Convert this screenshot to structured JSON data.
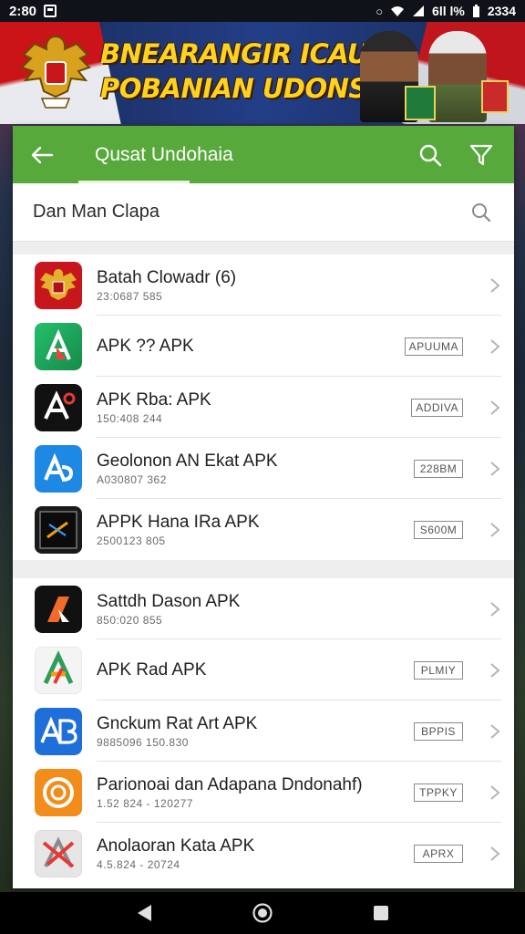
{
  "status_bar": {
    "time": "2:80",
    "right_text": "6ll l% ",
    "clock": "2334"
  },
  "banner": {
    "title_line1": "BNEARANGIR ICAUAN",
    "title_line2": "POBANIAN UDONSN!"
  },
  "toolbar": {
    "title": "Qusat Undohaia",
    "back_icon": "arrow-left-icon",
    "search_icon": "search-icon",
    "filter_icon": "filter-icon",
    "color": "#57a93b"
  },
  "search": {
    "query": "Dan Man Clapa"
  },
  "list_group1": [
    {
      "name": "Batah Clowadr (6)",
      "sub": "23:0687 585",
      "tag": "",
      "icon": "garuda-icon",
      "color": "#c8161d"
    },
    {
      "name": "APK ?? APK",
      "sub": "",
      "tag": "APUUMA",
      "icon": "green-a-icon",
      "color": "#1fa35a"
    },
    {
      "name": "APK Rba: APK",
      "sub": "150:408 244",
      "tag": "ADDIVA",
      "icon": "black-a-icon",
      "color": "#111111"
    },
    {
      "name": "Geolonon AN Ekat APK",
      "sub": "A030807 362",
      "tag": "228BM",
      "icon": "blue-a-icon",
      "color": "#1e88e5"
    },
    {
      "name": "APPK Hana IRa APK",
      "sub": "2500123 805",
      "tag": "S600M",
      "icon": "dark-square-icon",
      "color": "#1a1a1a"
    }
  ],
  "list_group2": [
    {
      "name": "Sattdh Dason APK",
      "sub": "850:020 855",
      "tag": "",
      "icon": "orange-slash-icon",
      "color": "#111111"
    },
    {
      "name": "APK Rad APK",
      "sub": "",
      "tag": "PLMIY",
      "icon": "rainbow-a-icon",
      "color": "#f4f4f4"
    },
    {
      "name": "Gnckum Rat Art APK",
      "sub": "9885096 150.830",
      "tag": "BPPIS",
      "icon": "blue-ab-icon",
      "color": "#1e6fd9"
    },
    {
      "name": "Parionoai dan Adapana Dndonahf)",
      "sub": "1.52 824 - 120277",
      "tag": "TPPKY",
      "icon": "orange-ring-icon",
      "color": "#f28c1a"
    },
    {
      "name": "Anolaoran Kata APK",
      "sub": "4.5.824 - 20724",
      "tag": "APRX",
      "icon": "red-x-a-icon",
      "color": "#e6e6e6"
    }
  ],
  "nav_bar": {
    "back": "back-triangle-icon",
    "home": "home-circle-icon",
    "recents": "recents-square-icon"
  }
}
